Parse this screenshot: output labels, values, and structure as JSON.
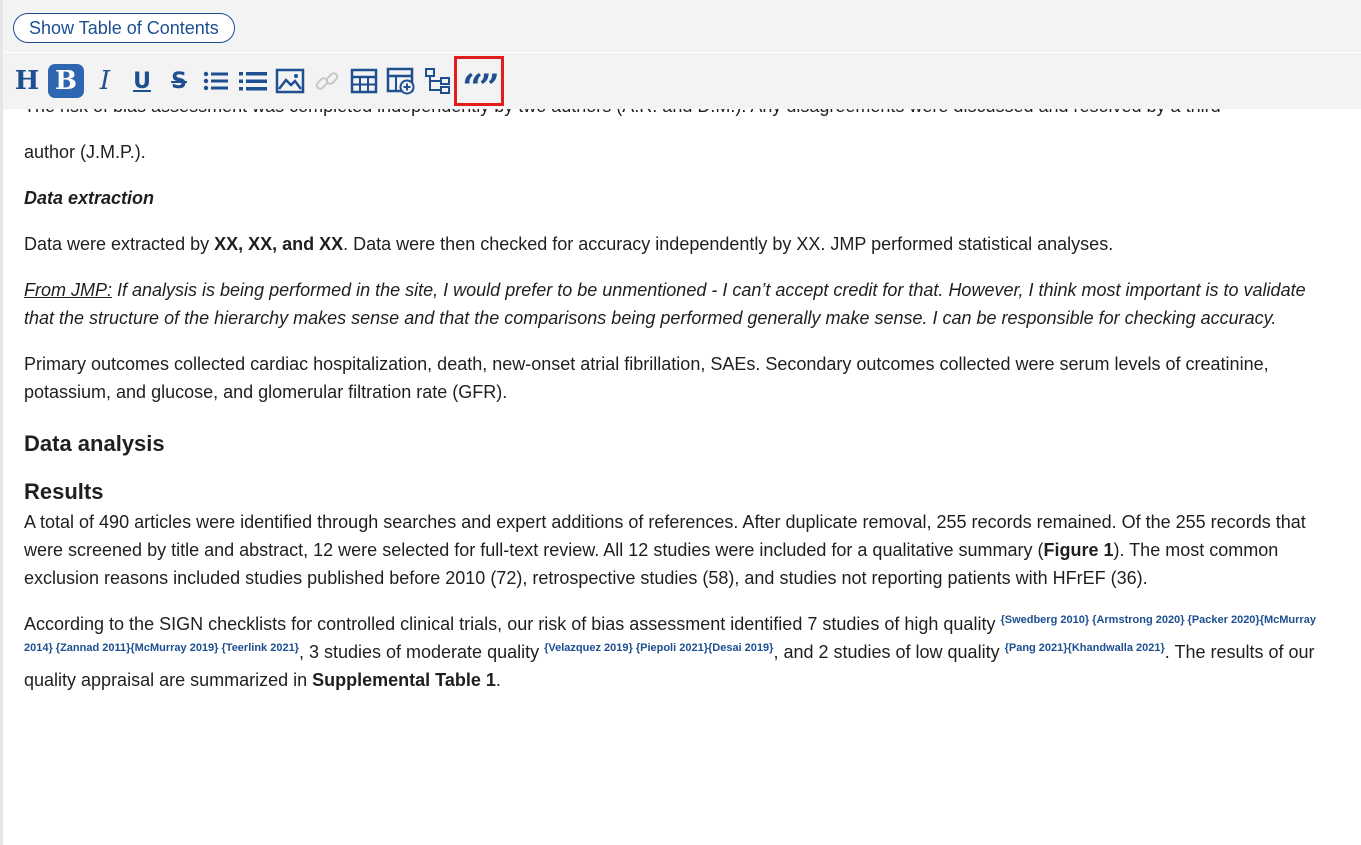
{
  "header": {
    "toc_button": "Show Table of Contents",
    "toolbar": [
      {
        "name": "heading-tool",
        "label": "H",
        "icon": "heading-icon"
      },
      {
        "name": "bold-tool",
        "label": "B",
        "icon": "bold-icon",
        "active": true
      },
      {
        "name": "italic-tool",
        "label": "I",
        "icon": "italic-icon"
      },
      {
        "name": "underline-tool",
        "label": "U",
        "icon": "underline-icon"
      },
      {
        "name": "strikethrough-tool",
        "label": "S",
        "icon": "strikethrough-icon"
      },
      {
        "name": "bullet-list-tool",
        "icon": "bullet-list-icon"
      },
      {
        "name": "numbered-list-tool",
        "icon": "numbered-list-icon"
      },
      {
        "name": "image-tool",
        "icon": "image-icon"
      },
      {
        "name": "link-tool",
        "icon": "link-icon",
        "disabled": true
      },
      {
        "name": "table-tool",
        "icon": "table-icon"
      },
      {
        "name": "add-table-tool",
        "icon": "table-add-icon"
      },
      {
        "name": "hierarchy-tool",
        "icon": "hierarchy-icon"
      },
      {
        "name": "citation-tool",
        "icon": "quote-icon",
        "highlighted": true
      }
    ],
    "accent_color": "#1d4f91",
    "highlight_color": "#e11d1d"
  },
  "document": {
    "clipped_line": "The risk of bias assessment was completed independently by two authors (A.R. and D.M.). Any disagreements were discussed and resolved by a third",
    "clipped_line_end": "author (J.M.P.).",
    "data_extraction": {
      "heading": "Data extraction",
      "p1_pre": "Data were extracted by ",
      "p1_bold": "XX, XX, and XX",
      "p1_post": ". Data were then checked for accuracy independently by XX. JMP performed statistical analyses.",
      "note_label": "From JMP:",
      "note_text": " If analysis is being performed in the site, I would prefer to be unmentioned - I can’t accept credit for that. However, I think most important is to validate that the structure of the hierarchy makes sense and that the comparisons being performed generally make sense. I can be responsible for checking accuracy.",
      "outcomes": "Primary outcomes collected cardiac hospitalization, death, new-onset atrial fibrillation, SAEs. Secondary outcomes collected were serum levels of creatinine, potassium, and glucose, and glomerular filtration rate (GFR)."
    },
    "data_analysis_heading": "Data analysis",
    "results": {
      "heading": "Results",
      "p1_pre": "A total of 490 articles were identified through searches and expert additions of references. After duplicate removal, 255 records remained. Of the 255 records that were screened by title and abstract, 12 were selected for full-text review. All 12 studies were included for a qualitative summary (",
      "p1_bold": "Figure 1",
      "p1_post": "). The most common exclusion reasons included studies published before 2010 (72), retrospective studies (58), and studies not reporting patients with HFrEF (36).",
      "p2_a": "According to the SIGN checklists for controlled clinical trials, our risk of bias assessment identified 7 studies of high quality ",
      "cite_high": "{Swedberg 2010} {Armstrong 2020} {Packer 2020}{McMurray 2014} {Zannad 2011}{McMurray 2019} {Teerlink 2021}",
      "p2_b": ", 3 studies of moderate quality ",
      "cite_mod": "{Velazquez 2019} {Piepoli 2021}{Desai 2019}",
      "p2_c": ", and 2 studies of low quality ",
      "cite_low": "{Pang 2021}{Khandwalla 2021}",
      "p2_d": ". The results of our quality appraisal are summarized in ",
      "p2_bold": "Supplemental Table 1",
      "p2_e": "."
    }
  }
}
